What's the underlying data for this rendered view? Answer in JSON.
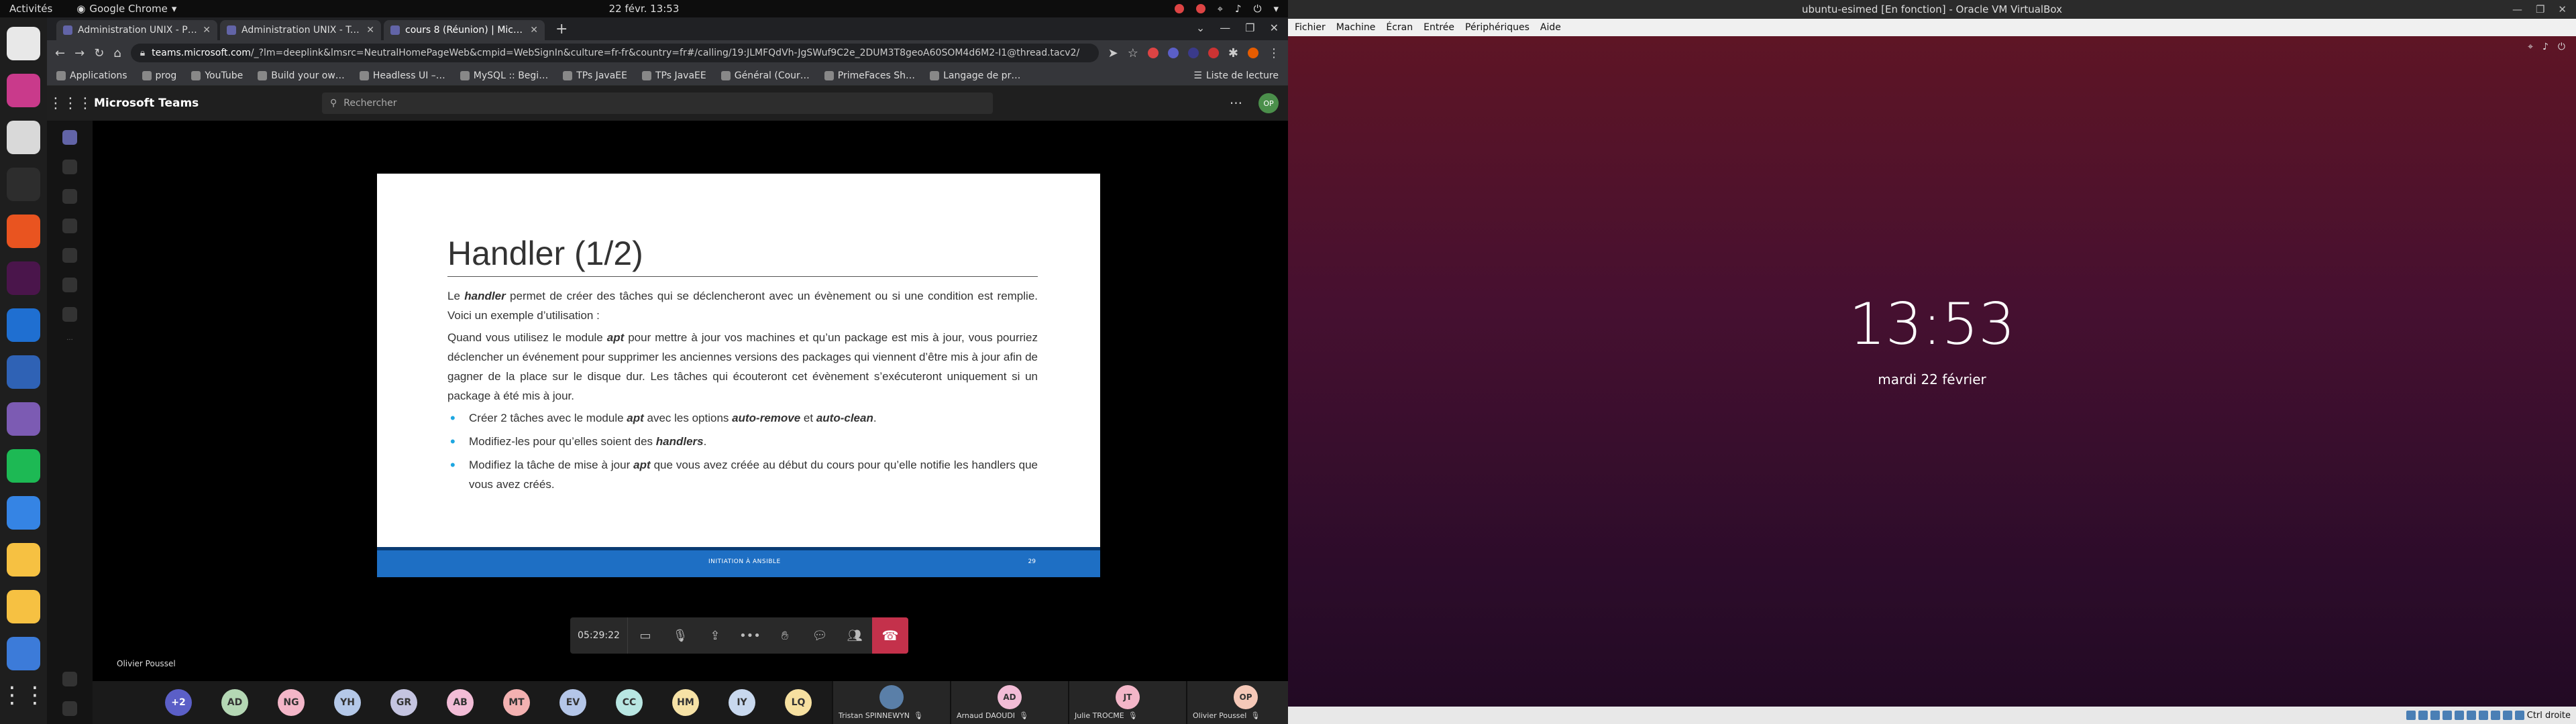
{
  "gnome": {
    "activities": "Activités",
    "app_menu": "Google Chrome",
    "clock": "22 févr.  13:53"
  },
  "dock": {
    "apps": [
      {
        "name": "chrome-icon",
        "color": "#e8e8e8"
      },
      {
        "name": "phpstorm-icon",
        "color": "#c93a8b"
      },
      {
        "name": "files-icon",
        "color": "#d9d9d9"
      },
      {
        "name": "terminal-icon",
        "color": "#2d2d2d"
      },
      {
        "name": "software-center-icon",
        "color": "#e95420"
      },
      {
        "name": "slack-icon",
        "color": "#4a154b"
      },
      {
        "name": "vscode-icon",
        "color": "#1f6fd1"
      },
      {
        "name": "virtualbox-icon",
        "color": "#2f62b5"
      },
      {
        "name": "emacs-icon",
        "color": "#7c5bb3"
      },
      {
        "name": "spotify-icon",
        "color": "#1db954"
      },
      {
        "name": "text-editor-icon",
        "color": "#3584e4"
      },
      {
        "name": "ssh-folder-icon",
        "color": "#f6c142"
      },
      {
        "name": "ssh-folder2-icon",
        "color": "#f6c142"
      },
      {
        "name": "vbox-cube-icon",
        "color": "#3c7bd9"
      }
    ]
  },
  "chrome": {
    "tabs": [
      {
        "title": "Administration UNIX - P…"
      },
      {
        "title": "Administration UNIX - Tr…"
      },
      {
        "title": "cours 8 (Réunion) | Mic…"
      }
    ],
    "url_host": "teams.microsoft.com",
    "url_path": "/_?lm=deeplink&lmsrc=NeutralHomePageWeb&cmpid=WebSignIn&culture=fr-fr&country=fr#/calling/19:JLMFQdVh-JgSWuf9C2e_2DUM3T8geoA60SOM4d6M2-I1@thread.tacv2/",
    "bookmarks": [
      "Applications",
      "prog",
      "YouTube",
      "Build your ow…",
      "Headless UI –…",
      "MySQL :: Begi…",
      "TPs JavaEE",
      "TPs JavaEE",
      "Général (Cour…",
      "PrimeFaces Sh…",
      "Langage de pr…"
    ],
    "reading_list": "Liste de lecture"
  },
  "teams": {
    "title": "Microsoft Teams",
    "search_placeholder": "Rechercher",
    "profile_initials": "OP",
    "timer": "05:29:22",
    "presenter": "Olivier Poussel",
    "roster_more": "+2",
    "roster": [
      {
        "initials": "AD",
        "color": "#b4d7b4"
      },
      {
        "initials": "NG",
        "color": "#f3b6c8"
      },
      {
        "initials": "YH",
        "color": "#b4c8e8"
      },
      {
        "initials": "GR",
        "color": "#c4c4e0"
      },
      {
        "initials": "AB",
        "color": "#f2bcd6"
      },
      {
        "initials": "MT",
        "color": "#f3b1b1"
      },
      {
        "initials": "EV",
        "color": "#b4c6e8"
      },
      {
        "initials": "CC",
        "color": "#b8e6e2"
      },
      {
        "initials": "HM",
        "color": "#f6e2a6"
      },
      {
        "initials": "IY",
        "color": "#c8d8ee"
      },
      {
        "initials": "LQ",
        "color": "#f6e0a0"
      }
    ],
    "tiles": [
      {
        "name": "Tristan SPINNEWYN",
        "initials": "",
        "color": "#5a7fa8"
      },
      {
        "name": "Arnaud DAOUDI",
        "initials": "AD",
        "color": "#f2bcd6"
      },
      {
        "name": "Julie TROCME",
        "initials": "JT",
        "color": "#f3b6c8"
      },
      {
        "name": "Olivier Poussel",
        "initials": "OP",
        "color": "#f5c8b8"
      }
    ]
  },
  "slide": {
    "title": "Handler (1/2)",
    "p1_pre": "Le ",
    "p1_kw": "handler",
    "p1_post": " permet de créer des tâches qui se déclencheront avec un évènement ou si une condition est remplie. Voici un exemple d’utilisation :",
    "p2_pre": "Quand vous utilisez le module ",
    "p2_kw": "apt",
    "p2_post": " pour mettre à jour vos machines et qu’un package est mis à jour, vous pourriez déclencher un événement pour supprimer les anciennes versions des packages qui viennent d’être mis à jour afin de gagner de la place sur le disque dur. Les tâches qui écouteront cet évènement s’exécuteront uniquement si un package à été mis à jour.",
    "b1_pre": "Créer 2 tâches avec le module ",
    "b1_kw1": "apt",
    "b1_mid": " avec les options ",
    "b1_kw2": "auto-remove",
    "b1_and": " et ",
    "b1_kw3": "auto-clean",
    "b1_end": ".",
    "b2_pre": "Modifiez-les pour qu’elles soient des ",
    "b2_kw": "handlers",
    "b2_end": ".",
    "b3_pre": "Modifiez la tâche de mise à jour ",
    "b3_kw": "apt",
    "b3_post": " que vous avez créée au début du cours pour qu’elle notifie les handlers que vous avez créés.",
    "footer": "INITIATION À ANSIBLE",
    "page": "29"
  },
  "vbox": {
    "title": "ubuntu-esimed [En fonction] - Oracle VM VirtualBox",
    "menu": [
      "Fichier",
      "Machine",
      "Écran",
      "Entrée",
      "Périphériques",
      "Aide"
    ],
    "lock_time": "13:53",
    "lock_date": "mardi 22 février",
    "host_key": "Ctrl droite"
  }
}
